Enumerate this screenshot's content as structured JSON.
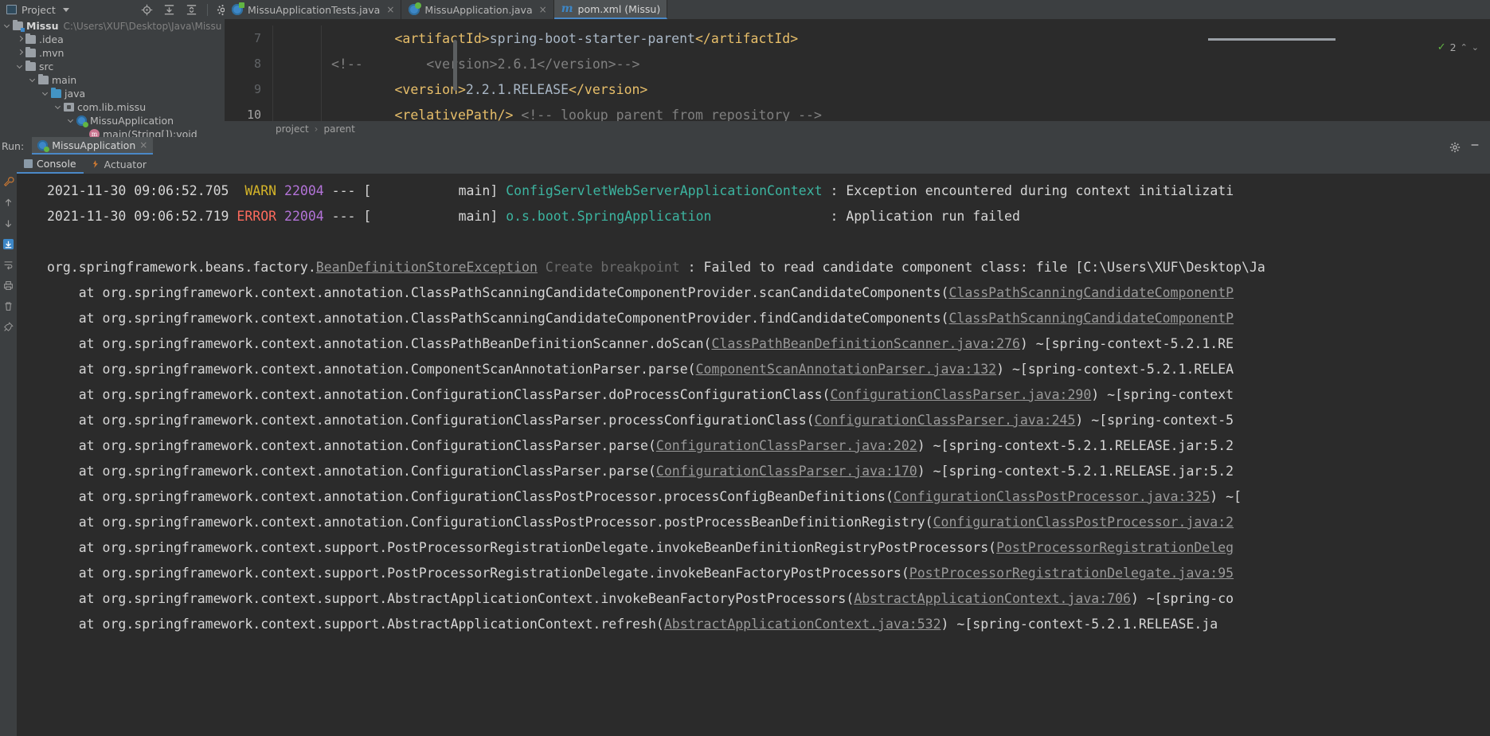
{
  "toolbar": {
    "project_label": "Project",
    "icons": [
      "locate-icon",
      "expand-all-icon",
      "collapse-all-icon",
      "settings-gear-icon",
      "hide-icon"
    ]
  },
  "tabs": [
    {
      "label": "MissuApplicationTests.java",
      "icon": "java-test-class-icon",
      "active": false,
      "close": "×"
    },
    {
      "label": "MissuApplication.java",
      "icon": "java-runnable-class-icon",
      "active": false,
      "close": "×"
    },
    {
      "label": "pom.xml (Missu)",
      "icon": "maven-icon",
      "active": true,
      "close": ""
    }
  ],
  "project_tree": [
    {
      "label": "Missu",
      "sub": "C:\\Users\\XUF\\Desktop\\Java\\Missu",
      "indent": 0,
      "arrow": "down",
      "icon": "project-folder-icon",
      "bold": true
    },
    {
      "label": ".idea",
      "sub": "",
      "indent": 1,
      "arrow": "right",
      "icon": "folder-icon",
      "bold": false
    },
    {
      "label": ".mvn",
      "sub": "",
      "indent": 1,
      "arrow": "right",
      "icon": "folder-icon",
      "bold": false
    },
    {
      "label": "src",
      "sub": "",
      "indent": 1,
      "arrow": "down",
      "icon": "folder-icon",
      "bold": false
    },
    {
      "label": "main",
      "sub": "",
      "indent": 2,
      "arrow": "down",
      "icon": "folder-icon",
      "bold": false
    },
    {
      "label": "java",
      "sub": "",
      "indent": 3,
      "arrow": "down",
      "icon": "source-folder-icon",
      "bold": false
    },
    {
      "label": "com.lib.missu",
      "sub": "",
      "indent": 4,
      "arrow": "down",
      "icon": "package-icon",
      "bold": false
    },
    {
      "label": "MissuApplication",
      "sub": "",
      "indent": 5,
      "arrow": "down",
      "icon": "java-class-icon",
      "bold": false
    },
    {
      "label": "main(String[]):void",
      "sub": "",
      "indent": 6,
      "arrow": "none",
      "icon": "method-icon",
      "bold": false
    }
  ],
  "editor": {
    "lines": [
      {
        "num": "7",
        "current": false,
        "segments": [
          {
            "t": "        ",
            "c": "txt"
          },
          {
            "t": "<artifactId>",
            "c": "tag"
          },
          {
            "t": "spring-boot-starter-parent",
            "c": "txt"
          },
          {
            "t": "</artifactId>",
            "c": "tag"
          }
        ]
      },
      {
        "num": "8",
        "current": false,
        "prefix": "<!--",
        "segments": [
          {
            "t": "        <version>2.6.1</version>-->",
            "c": "com"
          }
        ]
      },
      {
        "num": "9",
        "current": false,
        "segments": [
          {
            "t": "        ",
            "c": "txt"
          },
          {
            "t": "<version>",
            "c": "tag"
          },
          {
            "t": "2.2.1.RELEASE",
            "c": "txt"
          },
          {
            "t": "</version>",
            "c": "tag"
          }
        ]
      },
      {
        "num": "10",
        "current": true,
        "segments": [
          {
            "t": "        ",
            "c": "txt"
          },
          {
            "t": "<relativePath/>",
            "c": "tag"
          },
          {
            "t": " <!-- lookup parent from repository -->",
            "c": "com"
          }
        ]
      }
    ],
    "breadcrumb": [
      "project",
      "parent"
    ],
    "inspection": {
      "count": "2",
      "check_icon": "inspection-ok-icon",
      "up_icon": "prev-error-icon",
      "down_icon": "next-error-icon"
    }
  },
  "run_window": {
    "title": "Run:",
    "config_name": "MissuApplication",
    "close": "×",
    "right_icons": [
      "settings-gear-icon",
      "hide-window-icon"
    ],
    "side_icons": [
      "rerun-icon",
      "scroll-up-icon",
      "scroll-down-icon",
      "soft-wrap-icon",
      "scroll-to-end-icon",
      "print-icon",
      "clear-all-icon",
      "pin-icon"
    ],
    "sub_tabs": [
      {
        "label": "Console",
        "icon": "console-icon",
        "active": true
      },
      {
        "label": "Actuator",
        "icon": "actuator-icon",
        "active": false
      }
    ]
  },
  "console_lines": [
    {
      "type": "log",
      "segments": [
        {
          "t": "2021-11-30 09:06:52.705",
          "c": "white"
        },
        {
          "t": "  ",
          "c": "white"
        },
        {
          "t": "WARN",
          "c": "warn"
        },
        {
          "t": " ",
          "c": "white"
        },
        {
          "t": "22004",
          "c": "pid"
        },
        {
          "t": " --- [           main] ",
          "c": "white"
        },
        {
          "t": "ConfigServletWebServerApplicationContext",
          "c": "logger"
        },
        {
          "t": " : Exception encountered during context initializati",
          "c": "white"
        }
      ]
    },
    {
      "type": "log",
      "segments": [
        {
          "t": "2021-11-30 09:06:52.719",
          "c": "white"
        },
        {
          "t": " ",
          "c": "white"
        },
        {
          "t": "ERROR",
          "c": "err"
        },
        {
          "t": " ",
          "c": "white"
        },
        {
          "t": "22004",
          "c": "pid"
        },
        {
          "t": " --- [           main] ",
          "c": "white"
        },
        {
          "t": "o.s.boot.SpringApplication",
          "c": "logger"
        },
        {
          "t": "               : Application run failed",
          "c": "white"
        }
      ]
    },
    {
      "type": "blank",
      "segments": []
    },
    {
      "type": "exception",
      "segments": [
        {
          "t": "org.springframework.beans.factory.",
          "c": "white"
        },
        {
          "t": "BeanDefinitionStoreException",
          "c": "exlink"
        },
        {
          "t": " Create breakpoint",
          "c": "bp"
        },
        {
          "t": " : Failed to read candidate component class: file [C:\\Users\\XUF\\Desktop\\Ja",
          "c": "white"
        }
      ]
    },
    {
      "type": "at",
      "segments": [
        {
          "t": "    at org.springframework.context.annotation.ClassPathScanningCandidateComponentProvider.scanCandidateComponents(",
          "c": "white"
        },
        {
          "t": "ClassPathScanningCandidateComponentP",
          "c": "link"
        }
      ]
    },
    {
      "type": "at",
      "segments": [
        {
          "t": "    at org.springframework.context.annotation.ClassPathScanningCandidateComponentProvider.findCandidateComponents(",
          "c": "white"
        },
        {
          "t": "ClassPathScanningCandidateComponentP",
          "c": "link"
        }
      ]
    },
    {
      "type": "at",
      "segments": [
        {
          "t": "    at org.springframework.context.annotation.ClassPathBeanDefinitionScanner.doScan(",
          "c": "white"
        },
        {
          "t": "ClassPathBeanDefinitionScanner.java:276",
          "c": "link"
        },
        {
          "t": ") ~[spring-context-5.2.1.RE",
          "c": "white"
        }
      ]
    },
    {
      "type": "at",
      "segments": [
        {
          "t": "    at org.springframework.context.annotation.ComponentScanAnnotationParser.parse(",
          "c": "white"
        },
        {
          "t": "ComponentScanAnnotationParser.java:132",
          "c": "link"
        },
        {
          "t": ") ~[spring-context-5.2.1.RELEA",
          "c": "white"
        }
      ]
    },
    {
      "type": "at",
      "segments": [
        {
          "t": "    at org.springframework.context.annotation.ConfigurationClassParser.doProcessConfigurationClass(",
          "c": "white"
        },
        {
          "t": "ConfigurationClassParser.java:290",
          "c": "link"
        },
        {
          "t": ") ~[spring-context",
          "c": "white"
        }
      ]
    },
    {
      "type": "at",
      "segments": [
        {
          "t": "    at org.springframework.context.annotation.ConfigurationClassParser.processConfigurationClass(",
          "c": "white"
        },
        {
          "t": "ConfigurationClassParser.java:245",
          "c": "link"
        },
        {
          "t": ") ~[spring-context-5",
          "c": "white"
        }
      ]
    },
    {
      "type": "at",
      "segments": [
        {
          "t": "    at org.springframework.context.annotation.ConfigurationClassParser.parse(",
          "c": "white"
        },
        {
          "t": "ConfigurationClassParser.java:202",
          "c": "link"
        },
        {
          "t": ") ~[spring-context-5.2.1.RELEASE.jar:5.2",
          "c": "white"
        }
      ]
    },
    {
      "type": "at",
      "segments": [
        {
          "t": "    at org.springframework.context.annotation.ConfigurationClassParser.parse(",
          "c": "white"
        },
        {
          "t": "ConfigurationClassParser.java:170",
          "c": "link"
        },
        {
          "t": ") ~[spring-context-5.2.1.RELEASE.jar:5.2",
          "c": "white"
        }
      ]
    },
    {
      "type": "at",
      "segments": [
        {
          "t": "    at org.springframework.context.annotation.ConfigurationClassPostProcessor.processConfigBeanDefinitions(",
          "c": "white"
        },
        {
          "t": "ConfigurationClassPostProcessor.java:325",
          "c": "link"
        },
        {
          "t": ") ~[",
          "c": "white"
        }
      ]
    },
    {
      "type": "at",
      "segments": [
        {
          "t": "    at org.springframework.context.annotation.ConfigurationClassPostProcessor.postProcessBeanDefinitionRegistry(",
          "c": "white"
        },
        {
          "t": "ConfigurationClassPostProcessor.java:2",
          "c": "link"
        }
      ]
    },
    {
      "type": "at",
      "segments": [
        {
          "t": "    at org.springframework.context.support.PostProcessorRegistrationDelegate.invokeBeanDefinitionRegistryPostProcessors(",
          "c": "white"
        },
        {
          "t": "PostProcessorRegistrationDeleg",
          "c": "link"
        }
      ]
    },
    {
      "type": "at",
      "segments": [
        {
          "t": "    at org.springframework.context.support.PostProcessorRegistrationDelegate.invokeBeanFactoryPostProcessors(",
          "c": "white"
        },
        {
          "t": "PostProcessorRegistrationDelegate.java:95",
          "c": "link"
        }
      ]
    },
    {
      "type": "at",
      "segments": [
        {
          "t": "    at org.springframework.context.support.AbstractApplicationContext.invokeBeanFactoryPostProcessors(",
          "c": "white"
        },
        {
          "t": "AbstractApplicationContext.java:706",
          "c": "link"
        },
        {
          "t": ") ~[spring-co",
          "c": "white"
        }
      ]
    },
    {
      "type": "at",
      "segments": [
        {
          "t": "    at org.springframework.context.support.AbstractApplicationContext.refresh(",
          "c": "white"
        },
        {
          "t": "AbstractApplicationContext.java:532",
          "c": "link"
        },
        {
          "t": ") ~[spring-context-5.2.1.RELEASE.ja",
          "c": "white"
        }
      ]
    }
  ]
}
